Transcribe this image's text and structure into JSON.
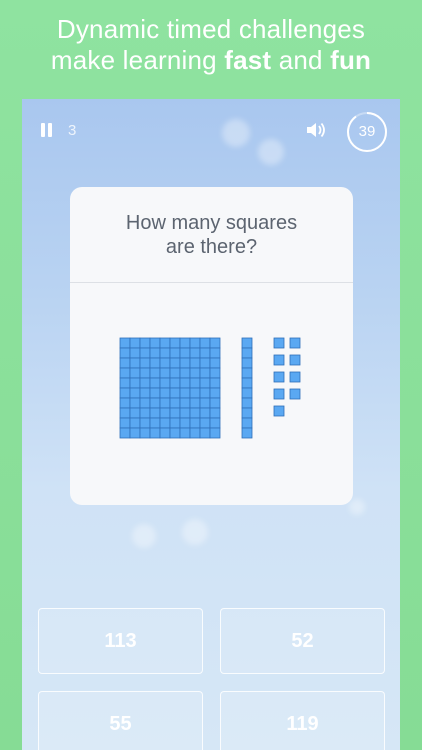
{
  "headline": {
    "line1": "Dynamic timed challenges",
    "line2_prefix": "make learning ",
    "line2_fast": "fast",
    "line2_and": " and ",
    "line2_fun": "fun"
  },
  "game": {
    "score": "3",
    "timer": "39",
    "timer_progress": 0.9,
    "question": "How many squares\nare there?",
    "blocks": {
      "hundreds": 1,
      "tens": 1,
      "ones": 9
    },
    "answers": [
      "113",
      "52",
      "55",
      "119"
    ]
  },
  "colors": {
    "accent_green": "#8fe3a0",
    "block_fill": "#5aa8f2",
    "block_stroke": "#2f6fb8"
  },
  "icons": [
    "pause-icon",
    "speaker-icon",
    "timer-ring-icon"
  ]
}
